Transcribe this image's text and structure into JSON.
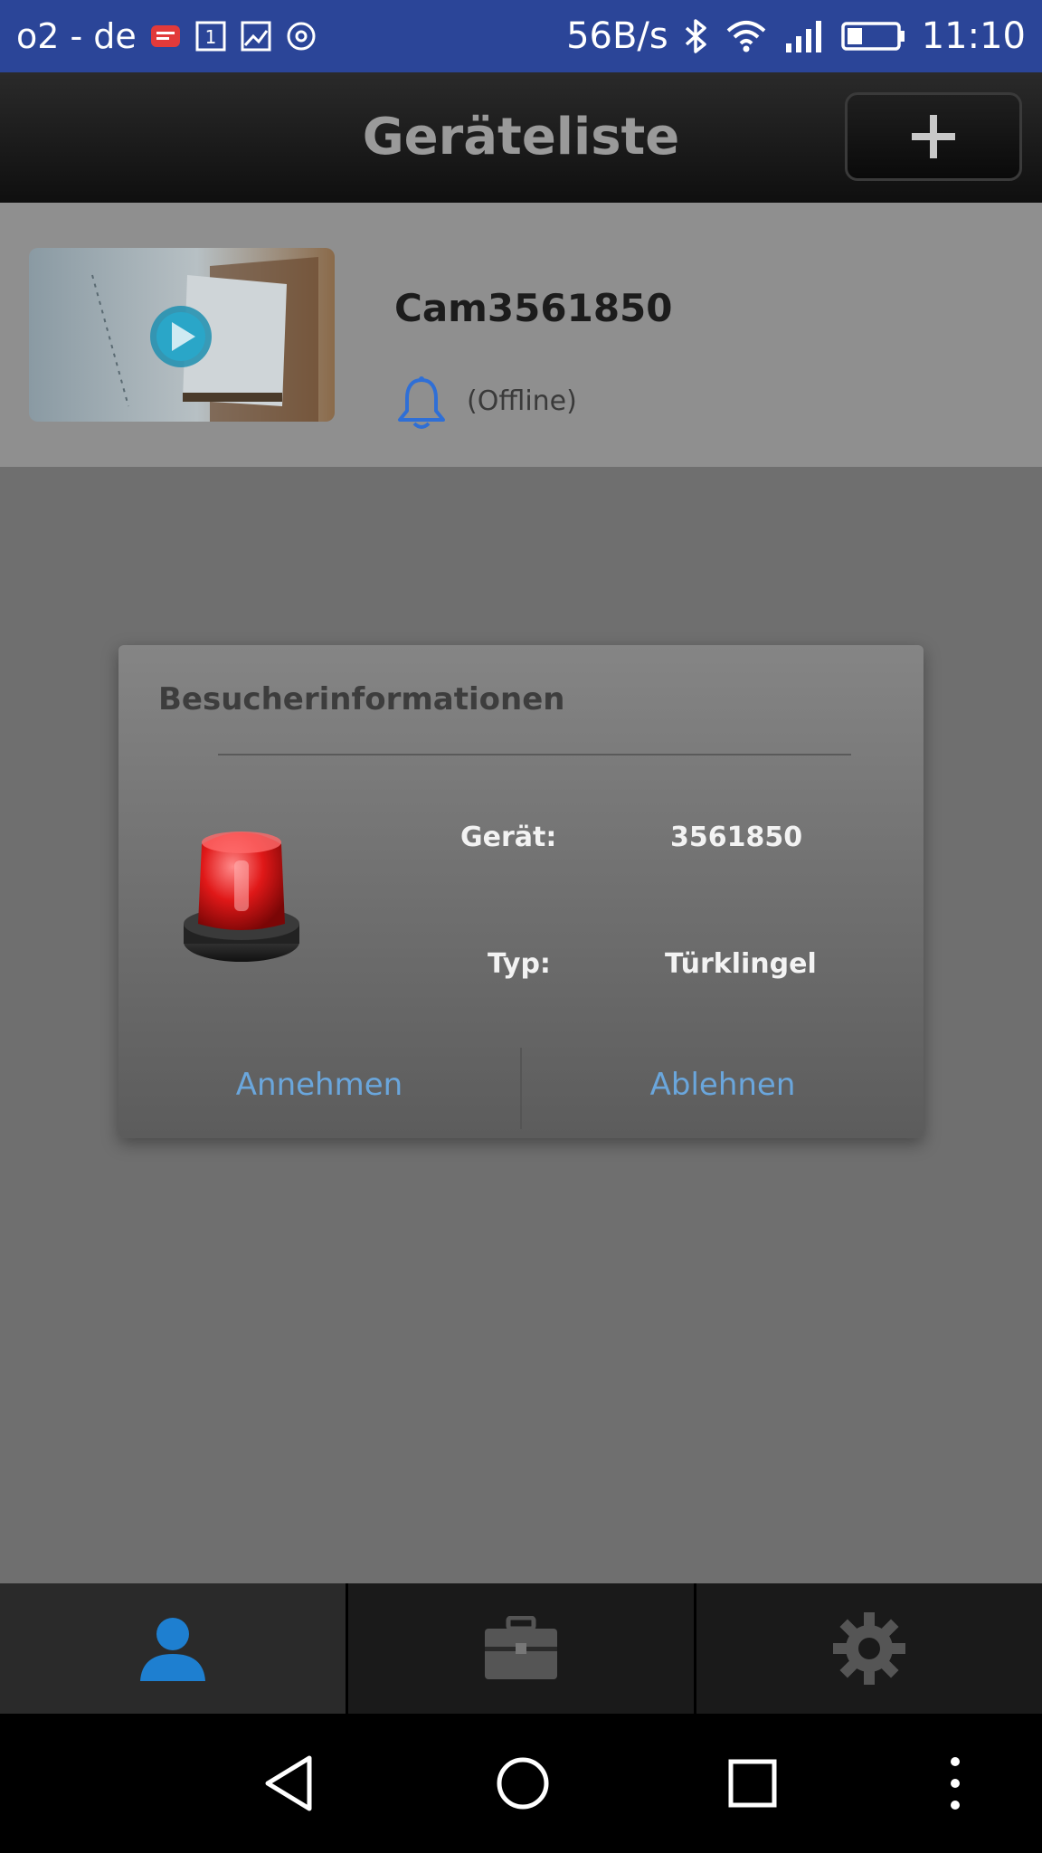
{
  "status_bar": {
    "carrier": "o2 - de",
    "net_speed": "56B/s",
    "time": "11:10",
    "icons": [
      "message-badge-icon",
      "sim-icon",
      "image-icon",
      "sync-icon",
      "bluetooth-icon",
      "wifi-icon",
      "signal-icon",
      "battery-icon"
    ]
  },
  "app_bar": {
    "title": "Geräteliste",
    "add_icon": "plus-icon"
  },
  "device_list": {
    "items": [
      {
        "name": "Cam3561850",
        "status": "(Offline)",
        "icon": "bell-icon"
      }
    ]
  },
  "dialog": {
    "title": "Besucherinformationen",
    "device_label": "Gerät:",
    "device_value": "3561850",
    "type_label": "Typ:",
    "type_value": "Türklingel",
    "accept_label": "Annehmen",
    "reject_label": "Ablehnen",
    "icon": "siren-icon"
  },
  "tab_bar": {
    "tabs": [
      {
        "icon": "person-icon",
        "active": true
      },
      {
        "icon": "toolbox-icon",
        "active": false
      },
      {
        "icon": "gear-icon",
        "active": false
      }
    ]
  },
  "nav_bar": {
    "icons": [
      "back-icon",
      "home-icon",
      "recents-icon",
      "overflow-icon"
    ]
  },
  "colors": {
    "status_bar": "#2b4598",
    "accent_blue": "#6aa6dc",
    "bell_blue": "#2f6fd6",
    "person_blue": "#1e7fd0"
  }
}
